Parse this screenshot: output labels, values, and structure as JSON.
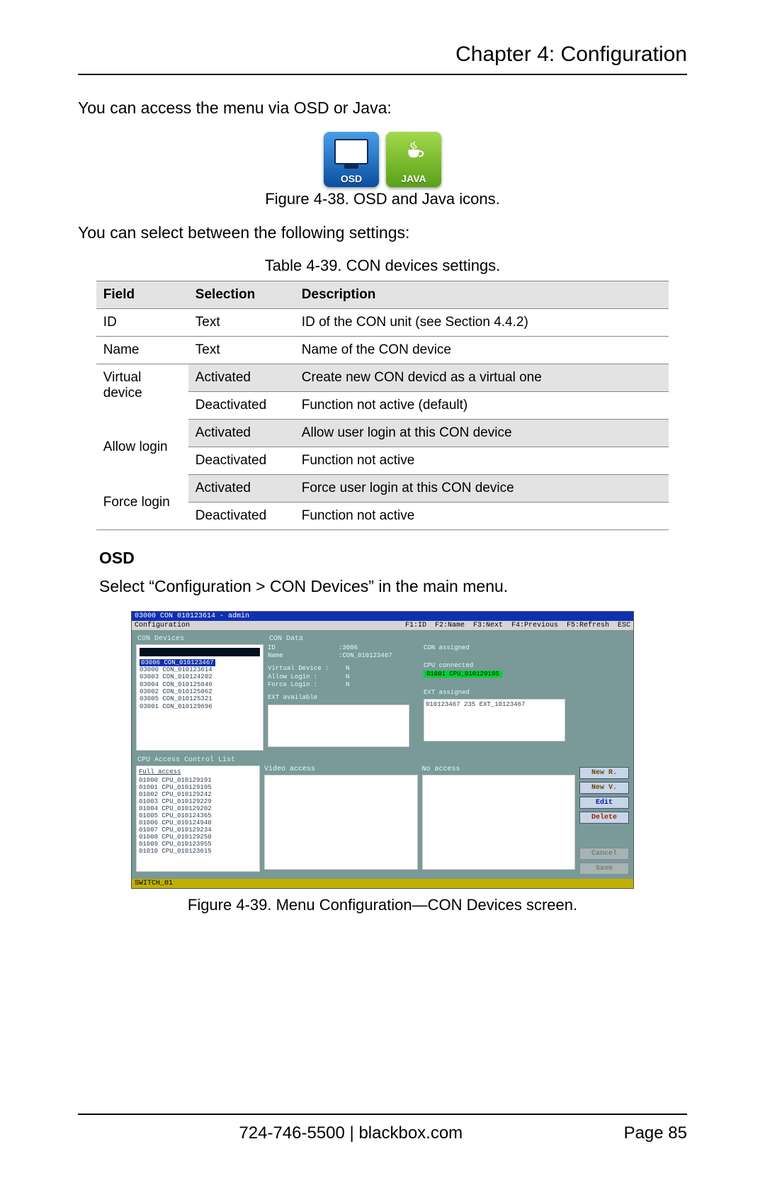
{
  "header": {
    "title": "Chapter 4: Configuration"
  },
  "intro1": "You can access the menu via OSD or Java:",
  "icons": {
    "osd_label": "OSD",
    "java_label": "JAVA"
  },
  "fig38": "Figure 4-38. OSD and Java icons.",
  "intro2": "You can select between the following settings:",
  "table39_caption": "Table 4-39. CON devices settings.",
  "table39": {
    "headers": {
      "c1": "Field",
      "c2": "Selection",
      "c3": "Description"
    },
    "rows": [
      {
        "field": "ID",
        "sel": "Text",
        "desc": "ID of the CON unit (see Section 4.4.2)",
        "alt": false
      },
      {
        "field": "Name",
        "sel": "Text",
        "desc": "Name of the CON device",
        "alt": false
      },
      {
        "field": "Virtual",
        "sel": "Activated",
        "desc": "Create new CON devicd as a virtual one",
        "alt": true
      },
      {
        "field": "device",
        "sel": "Deactivated",
        "desc": "Function not active (default)",
        "alt": false
      },
      {
        "field": "",
        "sel": "Activated",
        "desc": "Allow user login at this CON device",
        "alt": true
      },
      {
        "field": "Allow login",
        "sel": "Deactivated",
        "desc": "Function not active",
        "alt": false
      },
      {
        "field": "",
        "sel": "Activated",
        "desc": "Force user login at this CON device",
        "alt": true
      },
      {
        "field": "Force login",
        "sel": "Deactivated",
        "desc": "Function not active",
        "alt": false
      }
    ]
  },
  "osd_section": {
    "title": "OSD",
    "instruction": "Select “Configuration > CON Devices” in the main menu."
  },
  "osd_screen": {
    "titlebar": "03000 CON 010123614 - admin",
    "menu_left": "Configuration",
    "menu_right": "F1:ID  F2:Name  F3:Next  F4:Previous  F5:Refresh  ESC",
    "left_panel_title": "CON Devices",
    "con_list_selected": "03006 CON_010123467",
    "con_list": [
      "03000 CON_010123614",
      "03003 CON_010124202",
      "03004 CON_010125846",
      "03002 CON_010125062",
      "03005 CON_010125321",
      "03001 CON_010129696"
    ],
    "right_panel_title": "CON Data",
    "data_id_label": "ID",
    "data_id_val": "3006",
    "data_name_label": "Name",
    "data_name_val": "CON_010123467",
    "virtual_label": "Virtual Device :",
    "virtual_val": "N",
    "allow_label": "Allow Login   :",
    "allow_val": "N",
    "force_label": "Force Login   :",
    "force_val": "N",
    "ext_avail_label": "EXT available",
    "con_assigned_label": "CON assigned",
    "cpu_connected_label": "CPU connected",
    "cpu_connected_val": "01001 CPU_010129195",
    "ext_assigned_label": "EXT assigned",
    "ext_assigned_val": "010123467 235 EXT_10123467",
    "cpu_title": "CPU Access Control List",
    "full_access": "Full access",
    "video_access": "Video access",
    "no_access": "No access",
    "cpu_list": [
      "01000 CPU_010129191",
      "01001 CPU_010129195",
      "01002 CPU_010129242",
      "01003 CPU_010129229",
      "01004 CPU_010129202",
      "01005 CPU_010124365",
      "01006 CPU_010124940",
      "01007 CPU_010129234",
      "01008 CPU_010129250",
      "01009 CPU_010123955",
      "01010 CPU_010123615"
    ],
    "buttons": {
      "new_r": "New R.",
      "new_v": "New V.",
      "edit": "Edit",
      "delete": "Delete",
      "cancel": "Cancel",
      "save": "Save"
    },
    "status": "SWITCH_01"
  },
  "fig39": "Figure 4-39. Menu Configuration—CON Devices screen.",
  "footer": {
    "center": "724-746-5500   |   blackbox.com",
    "page": "Page 85"
  }
}
